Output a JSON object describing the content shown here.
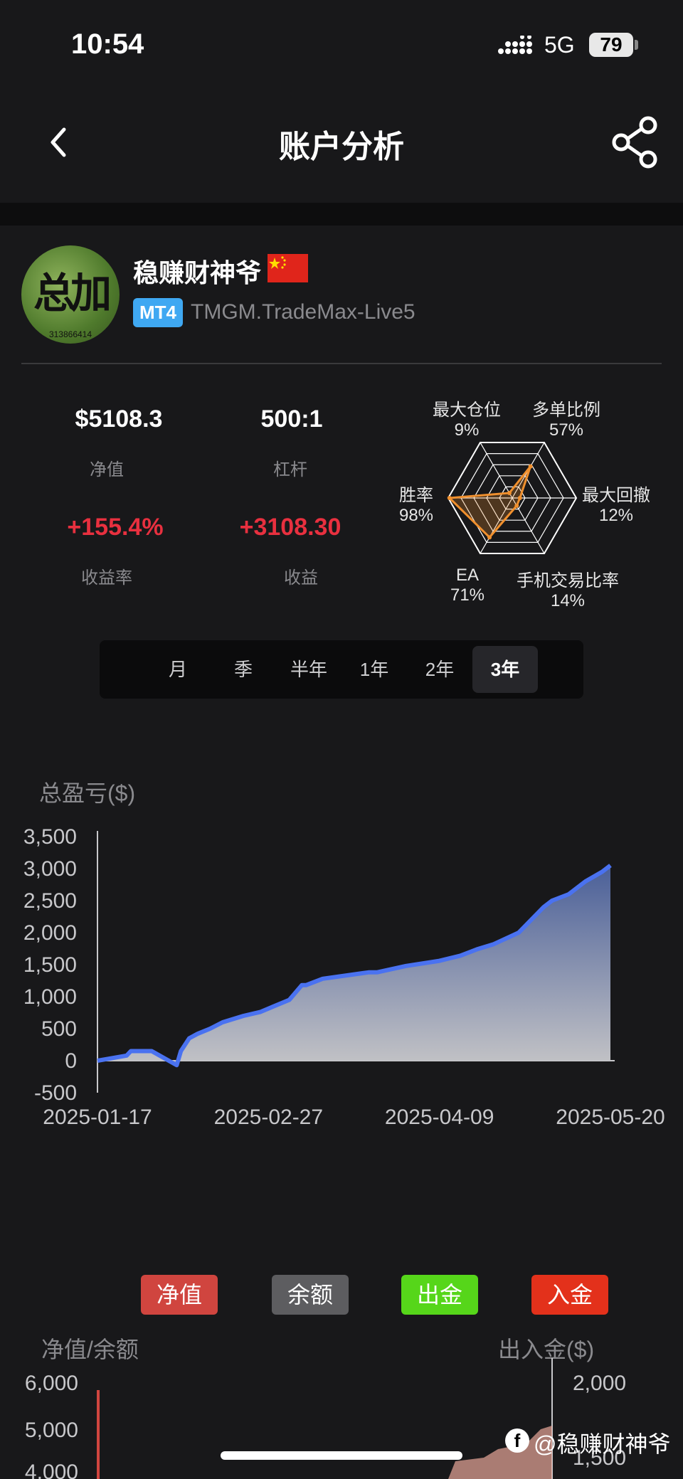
{
  "status_bar": {
    "time": "10:54",
    "network": "5G",
    "battery": "79"
  },
  "nav": {
    "title": "账户分析"
  },
  "profile": {
    "name": "稳赚财神爷",
    "avatar_text": "总加",
    "avatar_id": "313866414",
    "platform": "MT4",
    "server": "TMGM.TradeMax-Live5"
  },
  "stats": {
    "equity_value": "$5108.3",
    "equity_label": "净值",
    "leverage_value": "500:1",
    "leverage_label": "杠杆",
    "return_value": "+155.4%",
    "return_label": "收益率",
    "profit_value": "+3108.30",
    "profit_label": "收益"
  },
  "radar": {
    "axes": [
      {
        "label": "最大仓位",
        "value_text": "9%",
        "value": 9
      },
      {
        "label": "多单比例",
        "value_text": "57%",
        "value": 57
      },
      {
        "label": "最大回撤",
        "value_text": "12%",
        "value": 12
      },
      {
        "label": "手机交易比率",
        "value_text": "14%",
        "value": 14
      },
      {
        "label": "EA",
        "value_text": "71%",
        "value": 71
      },
      {
        "label": "胜率",
        "value_text": "98%",
        "value": 98
      }
    ],
    "color": "#f0902e"
  },
  "periods": {
    "items": [
      "月",
      "季",
      "半年",
      "1年",
      "2年",
      "3年"
    ],
    "active": "3年"
  },
  "chart_data": {
    "type": "area",
    "title": "总盈亏($)",
    "xlabel": "",
    "ylabel": "总盈亏($)",
    "ylim": [
      -500,
      3500
    ],
    "yticks": [
      "3,500",
      "3,000",
      "2,500",
      "2,000",
      "1,500",
      "1,000",
      "500",
      "0",
      "-500"
    ],
    "xticks": [
      "2025-01-17",
      "2025-02-27",
      "2025-04-09",
      "2025-05-20"
    ],
    "x": [
      "2025-01-17",
      "2025-01-24",
      "2025-01-25",
      "2025-01-30",
      "2025-02-05",
      "2025-02-06",
      "2025-02-07",
      "2025-02-08",
      "2025-02-10",
      "2025-02-13",
      "2025-02-16",
      "2025-02-21",
      "2025-02-25",
      "2025-03-04",
      "2025-03-07",
      "2025-03-08",
      "2025-03-12",
      "2025-03-23",
      "2025-03-25",
      "2025-04-01",
      "2025-04-09",
      "2025-04-14",
      "2025-04-18",
      "2025-04-22",
      "2025-04-28",
      "2025-05-04",
      "2025-05-06",
      "2025-05-10",
      "2025-05-14",
      "2025-05-18",
      "2025-05-20"
    ],
    "values": [
      0,
      80,
      150,
      150,
      -70,
      150,
      250,
      350,
      420,
      500,
      600,
      700,
      760,
      950,
      1180,
      1180,
      1280,
      1380,
      1380,
      1480,
      1560,
      1640,
      1740,
      1820,
      2000,
      2400,
      2500,
      2600,
      2800,
      2950,
      3050
    ],
    "line_color": "#4a72f0"
  },
  "legend": {
    "equity": "净值",
    "balance": "余额",
    "withdraw": "出金",
    "deposit": "入金",
    "equity_color": "#d0453f",
    "balance_color": "#5d5d60",
    "withdraw_color": "#56d61a",
    "deposit_color": "#e3311b"
  },
  "bottom_chart": {
    "left_title": "净值/余额",
    "right_title": "出入金($)",
    "left_ticks": [
      "6,000",
      "5,000",
      "4,000"
    ],
    "right_ticks": [
      "2,000",
      "1,500"
    ]
  },
  "watermark": "@稳赚财神爷"
}
